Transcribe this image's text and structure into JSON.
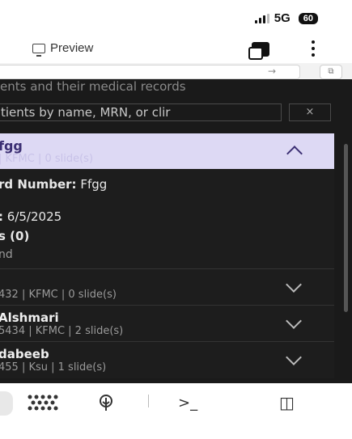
{
  "statusbar": {
    "network": "5G",
    "battery": "60"
  },
  "toolbar": {
    "preview_label": "Preview"
  },
  "url": {
    "arrow": "→",
    "open_icon": "⧉"
  },
  "page": {
    "subtitle": "ents and their medical records",
    "search_placeholder": "tients by name, MRN, or clir",
    "clear_label": "×"
  },
  "expanded_patient": {
    "name": "fgg",
    "meta": "| KFMC | 0 slide(s)",
    "record_number_label": "rd Number:",
    "record_number_value": "Ffgg",
    "date_label": ":",
    "date_value": "6/5/2025",
    "slides_label": "s (0)",
    "slides_status": "nd"
  },
  "patients": [
    {
      "name": "",
      "meta": "432 | KFMC | 0 slide(s)"
    },
    {
      "name": "Alshmari",
      "meta": "5434 | KFMC | 2 slide(s)"
    },
    {
      "name": "dabeeb",
      "meta": "455 | Ksu | 1 slide(s)"
    }
  ],
  "bottombar": {
    "icons": [
      "apps-icon",
      "tree-icon",
      "terminal-icon",
      "device-icon"
    ],
    "terminal_glyph": ">_",
    "device_glyph": "◫"
  },
  "colors": {
    "accent_header": "#ddd9f4",
    "background": "#1a1a1a"
  }
}
